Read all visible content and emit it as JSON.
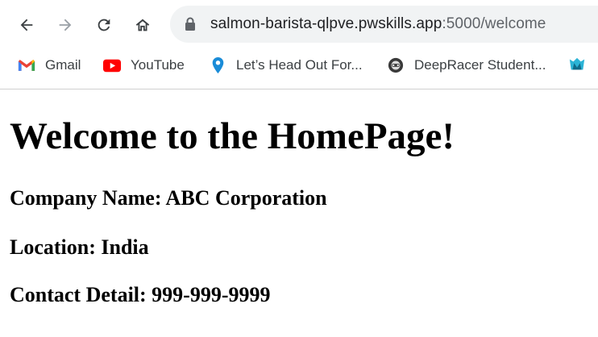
{
  "browser": {
    "url_main": "salmon-barista-qlpve.pwskills.app",
    "url_rest": ":5000/welcome",
    "bookmarks": [
      {
        "label": "Gmail",
        "icon": "gmail-icon"
      },
      {
        "label": "YouTube",
        "icon": "youtube-icon"
      },
      {
        "label": "Let’s Head Out For...",
        "icon": "location-pin-icon"
      },
      {
        "label": "DeepRacer Student...",
        "icon": "deepracer-icon"
      },
      {
        "label": "",
        "icon": "extra-bookmark-icon"
      }
    ]
  },
  "page": {
    "heading": "Welcome to the HomePage!",
    "company": "Company Name: ABC Corporation",
    "location": "Location: India",
    "contact": "Contact Detail: 999-999-9999"
  },
  "colors": {
    "omnibox_bg": "#f1f3f4",
    "icon_dark": "#3c4043",
    "icon_disabled": "#9aa0a6",
    "youtube_red": "#ff0000",
    "pin_blue": "#1a8cd8"
  }
}
